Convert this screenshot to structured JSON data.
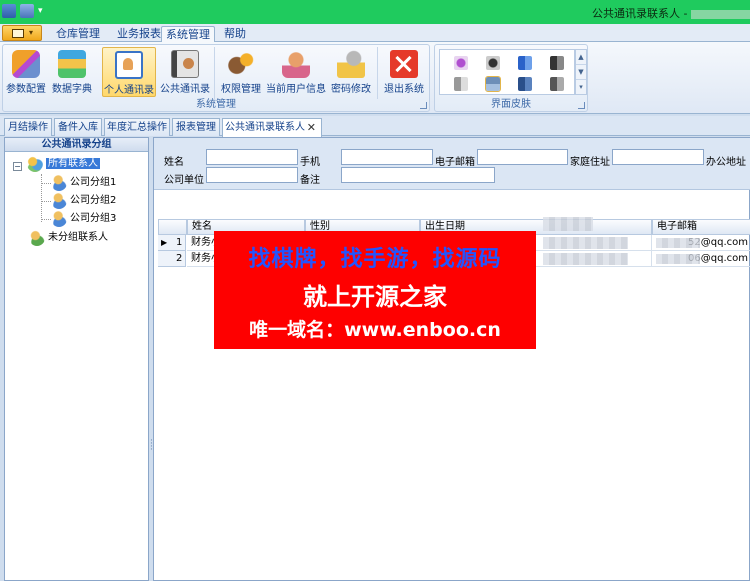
{
  "window": {
    "title": "公共通讯录联系人 -",
    "title_suffix": "件科"
  },
  "ribbon_tabs": [
    {
      "label": "仓库管理"
    },
    {
      "label": "业务报表"
    },
    {
      "label": "系统管理",
      "active": true
    },
    {
      "label": "帮助"
    }
  ],
  "ribbon": {
    "system_group": {
      "label": "系统管理",
      "buttons": [
        {
          "label": "参数配置",
          "icon": "tools-icon"
        },
        {
          "label": "数据字典",
          "icon": "books-icon"
        },
        {
          "label": "个人通讯录",
          "icon": "contact-card-icon",
          "active": true
        },
        {
          "label": "公共通讯录",
          "icon": "address-book-icon"
        },
        {
          "label": "权限管理",
          "icon": "key-icon"
        },
        {
          "label": "当前用户信息",
          "icon": "user-info-icon"
        },
        {
          "label": "密码修改",
          "icon": "password-icon"
        },
        {
          "label": "退出系统",
          "icon": "exit-icon"
        }
      ]
    },
    "skin_group": {
      "label": "界面皮肤"
    }
  },
  "doc_tabs": [
    {
      "label": "月结操作"
    },
    {
      "label": "备件入库"
    },
    {
      "label": "年度汇总操作"
    },
    {
      "label": "报表管理"
    },
    {
      "label": "公共通讯录联系人",
      "active": true
    }
  ],
  "tree": {
    "header": "公共通讯录分组",
    "root": "所有联系人",
    "children": [
      "公司分组1",
      "公司分组2",
      "公司分组3"
    ],
    "ungrouped": "未分组联系人"
  },
  "filter": {
    "name": "姓名",
    "mobile": "手机",
    "email": "电子邮箱",
    "home_address": "家庭住址",
    "office_address": "办公地址",
    "company": "公司单位",
    "remark": "备注"
  },
  "grid": {
    "columns": [
      "姓名",
      "性别",
      "出生日期",
      "电子邮箱"
    ],
    "rows": [
      {
        "no": "1",
        "name": "财务小",
        "email": "52@qq.com",
        "current": true
      },
      {
        "no": "2",
        "name": "财务小",
        "email": "06@qq.com"
      }
    ]
  },
  "watermark": {
    "line1": "找棋牌，找手游，找源码",
    "line2": "就上开源之家",
    "line3": "唯一域名：www.enboo.cn"
  },
  "colors": {
    "titlebar": "#1fcb5e",
    "ribbon": "#dfe8f5",
    "watermark_bg": "#fe0000",
    "watermark_accent": "#2255ff",
    "selection": "#3779d8"
  }
}
